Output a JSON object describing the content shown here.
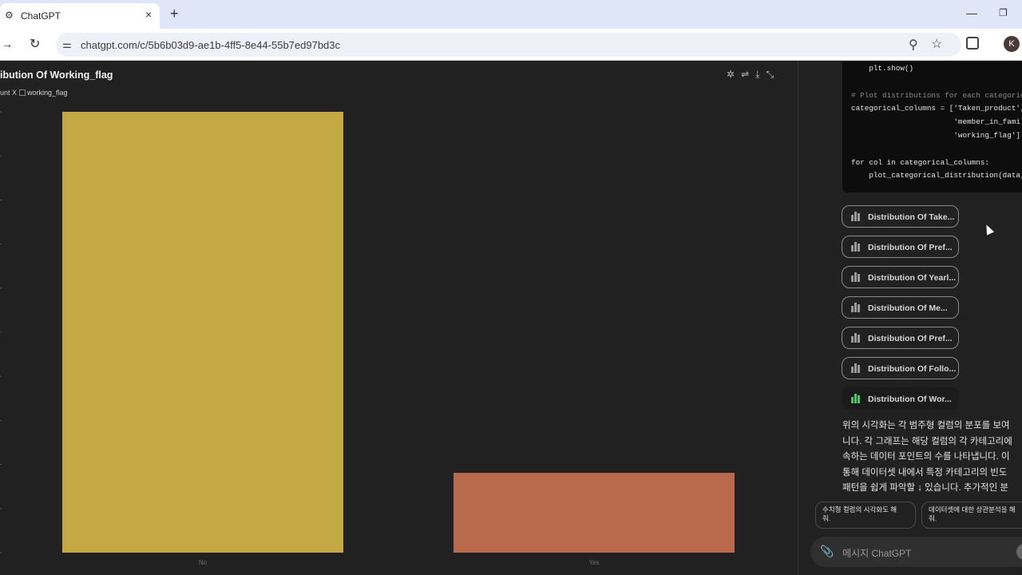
{
  "browser": {
    "tab_title": "ChatGPT",
    "tab_close": "×",
    "new_tab": "+",
    "url": "chatgpt.com/c/5b6b03d9-ae1b-4ff5-8e44-55b7ed97bd3c",
    "profile_initial": "K"
  },
  "chart_panel": {
    "title": "ibution Of Working_flag",
    "legend_prefix": "unt X",
    "legend_label": "working_flag"
  },
  "chart_data": {
    "type": "bar",
    "categories": [
      "No",
      "Yes"
    ],
    "values": [
      1000,
      181
    ],
    "colors": [
      "#c4a843",
      "#b96a4c"
    ],
    "ylim": [
      0,
      1000
    ],
    "legend": "top-left"
  },
  "code": {
    "lines": [
      "    plt.show()",
      "",
      "# Plot distributions for each categorica",
      "categorical_columns = ['Taken_product',",
      "                       'member_in_family",
      "                       'working_flag']",
      "",
      "for col in categorical_columns:",
      "    plot_categorical_distribution(data,"
    ]
  },
  "chart_buttons": [
    {
      "label": "Distribution Of Take..."
    },
    {
      "label": "Distribution Of Pref..."
    },
    {
      "label": "Distribution Of Yearl..."
    },
    {
      "label": "Distribution Of Me..."
    },
    {
      "label": "Distribution Of Pref..."
    },
    {
      "label": "Distribution Of Follo..."
    },
    {
      "label": "Distribution Of Wor..."
    }
  ],
  "answer_lines": [
    "위의 시각화는 각 범주형 컬럼의 분포를 보여",
    "니다. 각 그래프는 해당 컬럼의 각 카테고리에",
    "속하는 데이터 포인트의 수를 나타냅니다. 이",
    "통해 데이터셋 내에서 특정 카테고리의 빈도",
    "패턴을 쉽게 파악할 ↓ 있습니다. 추가적인 분"
  ],
  "suggestions": [
    {
      "line1": "수치형 컬럼의 시각화도 해",
      "line2": "줘."
    },
    {
      "line1": "데이터셋에 대한 상관분석을 해",
      "line2": "줘."
    }
  ],
  "input": {
    "placeholder": "메시지 ChatGPT"
  }
}
